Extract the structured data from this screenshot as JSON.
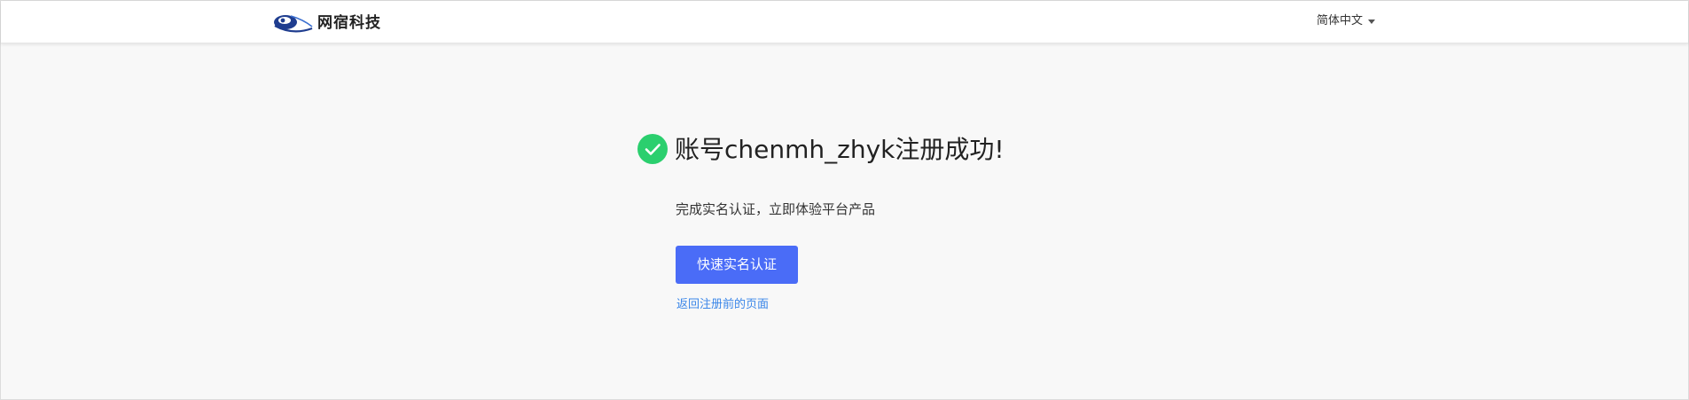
{
  "header": {
    "logo_text": "网宿科技",
    "language": {
      "selected": "简体中文",
      "icon": "chevron-down-icon"
    }
  },
  "main": {
    "status_icon": "check-circle-icon",
    "title": "账号chenmh_zhyk注册成功!",
    "subtitle": "完成实名认证，立即体验平台产品",
    "primary_button_label": "快速实名认证",
    "back_link_label": "返回注册前的页面"
  },
  "colors": {
    "success": "#2bcf6e",
    "primary": "#4a6cf7",
    "link": "#3a86e8",
    "page_background": "#f8f8f8",
    "header_background": "#ffffff"
  }
}
